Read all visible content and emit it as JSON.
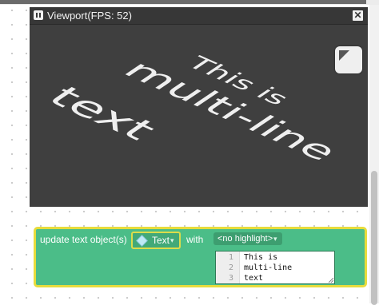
{
  "viewport": {
    "title": "Viewport(FPS: 52)",
    "pause_icon": "pause-icon",
    "close_icon": "close-icon",
    "close_glyph": "✕",
    "fullscreen_icon": "fullscreen-icon",
    "scene_text_lines": [
      "This is",
      "multi-line",
      "text"
    ]
  },
  "block": {
    "label": "update text object(s)",
    "object_param": {
      "icon": "cube-icon",
      "label": "Text",
      "arrow": "▾"
    },
    "with_label": "with",
    "highlight_dropdown": {
      "value": "<no highlight>",
      "arrow": "▾"
    },
    "editor": {
      "lines": [
        {
          "number": "1",
          "text": "This is"
        },
        {
          "number": "2",
          "text": "multi-line"
        },
        {
          "number": "3",
          "text": "text"
        }
      ]
    }
  },
  "colors": {
    "viewport_bg": "#3f3f3f",
    "block_green": "#4bbd88",
    "block_outline": "#e7dc3c",
    "scene_text": "#efefef"
  }
}
